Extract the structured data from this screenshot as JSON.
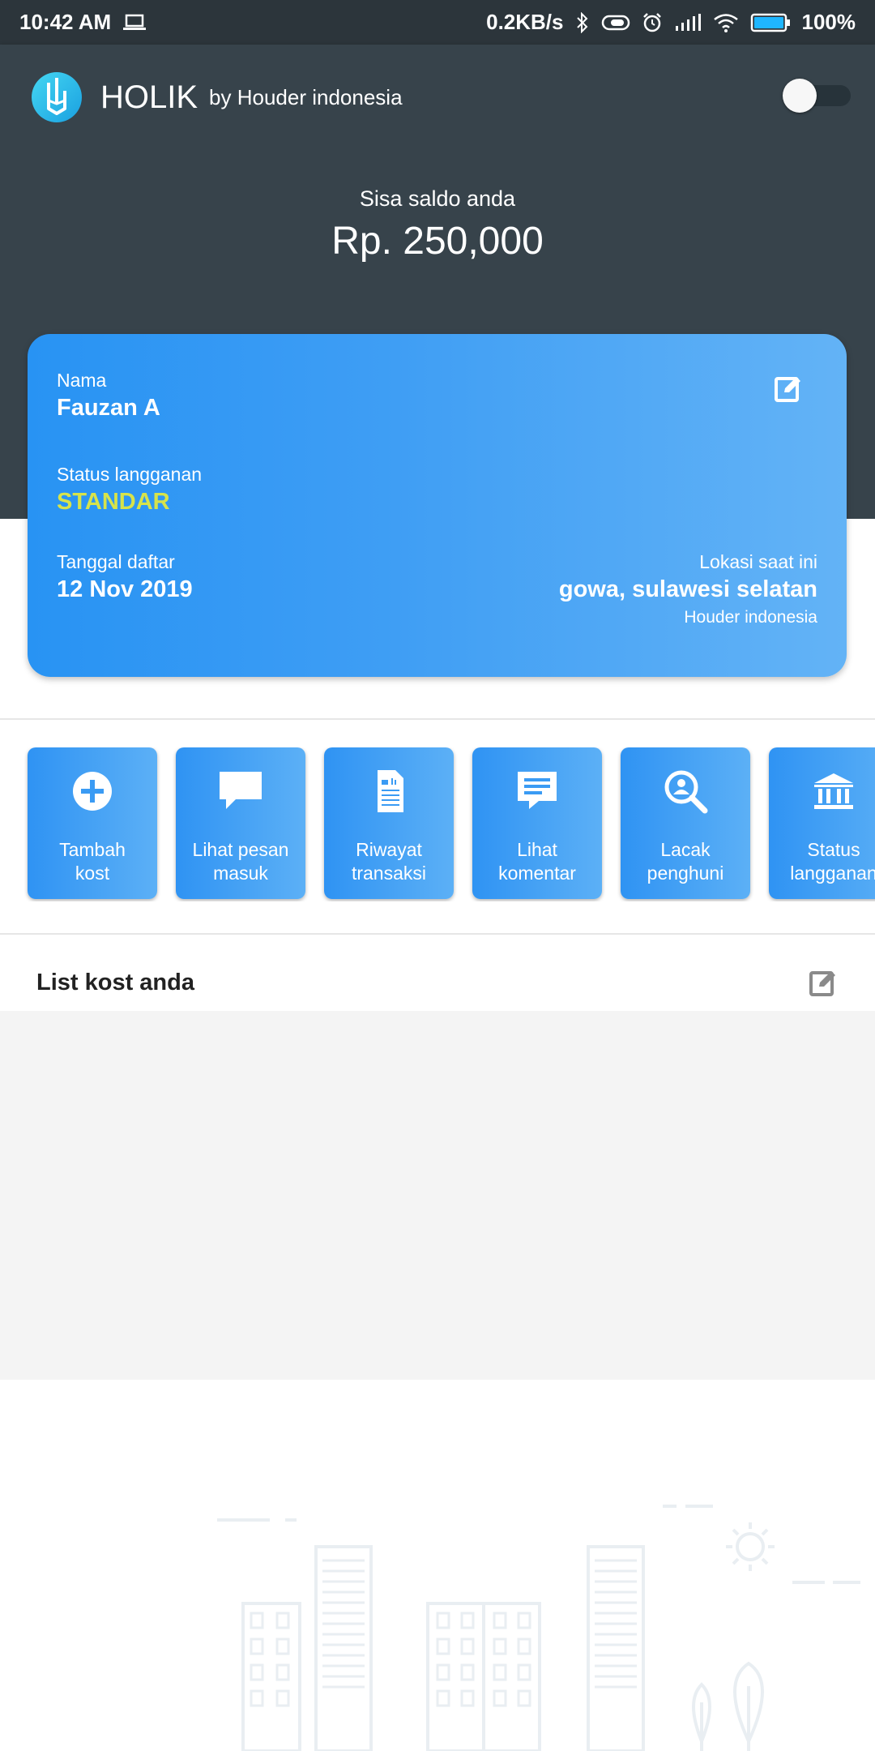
{
  "status_bar": {
    "time": "10:42 AM",
    "network_speed": "0.2KB/s",
    "battery": "100%"
  },
  "app_bar": {
    "title": "HOLIK",
    "subtitle": "by Houder indonesia",
    "toggle_on": false
  },
  "balance": {
    "label": "Sisa saldo anda",
    "value": "Rp. 250,000"
  },
  "profile_card": {
    "name_label": "Nama",
    "name_value": "Fauzan A",
    "status_label": "Status langganan",
    "status_value": "STANDAR",
    "date_label": "Tanggal daftar",
    "date_value": "12 Nov 2019",
    "location_label": "Lokasi saat ini",
    "location_value": "gowa, sulawesi selatan",
    "location_sub": "Houder indonesia"
  },
  "menu": {
    "items": [
      {
        "label": "Tambah\nkost",
        "icon": "plus-circle-icon"
      },
      {
        "label": "Lihat pesan\nmasuk",
        "icon": "chat-bubble-icon"
      },
      {
        "label": "Riwayat\ntransaksi",
        "icon": "document-icon"
      },
      {
        "label": "Lihat\nkomentar",
        "icon": "comment-icon"
      },
      {
        "label": "Lacak\npenghuni",
        "icon": "search-person-icon"
      },
      {
        "label": "Status\nlangganan",
        "icon": "bank-icon"
      }
    ]
  },
  "list": {
    "title": "List kost anda"
  },
  "colors": {
    "header_bg": "#37434b",
    "status_bar_bg": "#2c353b",
    "card_blue": "#2893f3",
    "card_blue_light": "#63b3f6",
    "status_yellow": "#d7e34a",
    "list_bg": "#f4f4f4"
  }
}
